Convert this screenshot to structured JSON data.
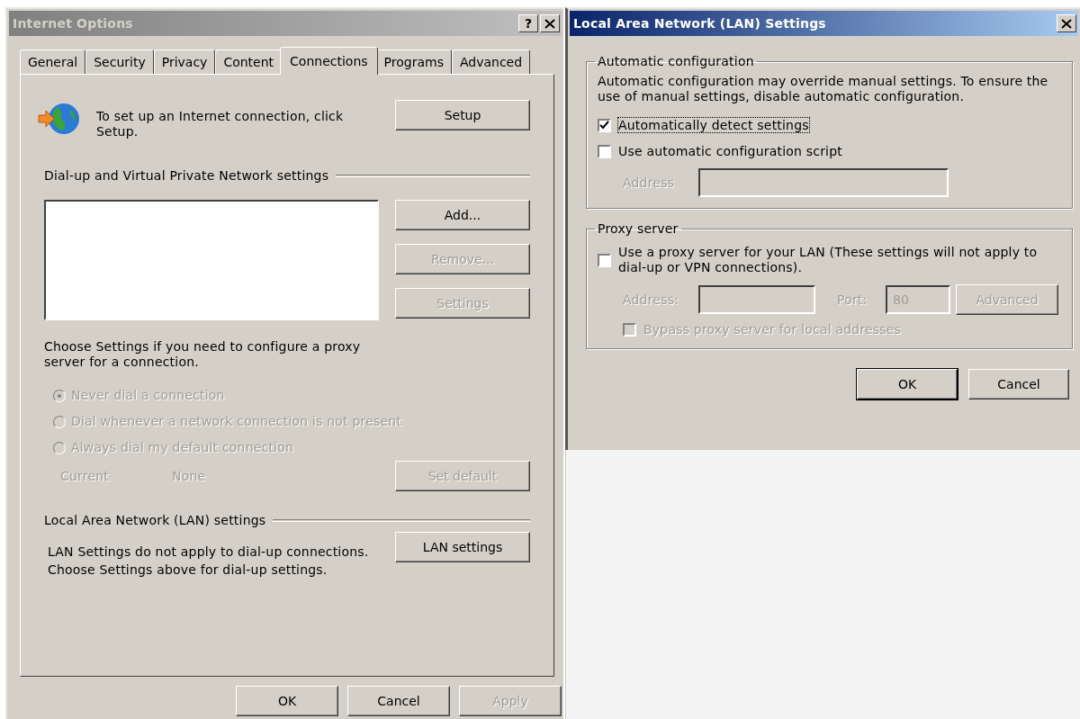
{
  "internet_options": {
    "title": "Internet Options",
    "help_button": "?",
    "tabs": [
      {
        "label": "General",
        "selected": false
      },
      {
        "label": "Security",
        "selected": false
      },
      {
        "label": "Privacy",
        "selected": false
      },
      {
        "label": "Content",
        "selected": false
      },
      {
        "label": "Connections",
        "selected": true
      },
      {
        "label": "Programs",
        "selected": false
      },
      {
        "label": "Advanced",
        "selected": false
      }
    ],
    "setup": {
      "text": "To set up an Internet connection, click Setup.",
      "button": "Setup"
    },
    "dialup": {
      "heading": "Dial-up and Virtual Private Network settings",
      "buttons": [
        {
          "label": "Add...",
          "disabled": false
        },
        {
          "label": "Remove...",
          "disabled": true
        },
        {
          "label": "Settings",
          "disabled": true
        }
      ]
    },
    "proxy_note": "Choose Settings if you need to configure a proxy server for a connection.",
    "dial_options": [
      {
        "label": "Never dial a connection",
        "selected": true,
        "disabled": true
      },
      {
        "label": "Dial whenever a network connection is not present",
        "selected": false,
        "disabled": true
      },
      {
        "label": "Always dial my default connection",
        "selected": false,
        "disabled": true
      }
    ],
    "current": {
      "label": "Current",
      "value": "None",
      "disabled": true
    },
    "set_default_button": {
      "label": "Set default",
      "disabled": true
    },
    "lan": {
      "heading": "Local Area Network (LAN) settings",
      "text": "LAN Settings do not apply to dial-up connections. Choose Settings above for dial-up settings.",
      "button": "LAN settings"
    },
    "footer_buttons": [
      {
        "label": "OK",
        "disabled": false
      },
      {
        "label": "Cancel",
        "disabled": false
      },
      {
        "label": "Apply",
        "disabled": true
      }
    ]
  },
  "lan_settings": {
    "title": "Local Area Network (LAN) Settings",
    "automatic_configuration": {
      "heading": "Automatic configuration",
      "text": "Automatic configuration may override manual settings.  To ensure the use of manual settings, disable automatic configuration.",
      "options": [
        {
          "label": "Automatically detect settings",
          "checked": true,
          "focused": true
        },
        {
          "label": "Use automatic configuration script",
          "checked": false,
          "focused": false
        }
      ],
      "address": {
        "label": "Address",
        "disabled": true
      }
    },
    "proxy_server": {
      "heading": "Proxy server",
      "option": {
        "label": "Use a proxy server for your LAN (These settings will not apply to dial-up or VPN connections).",
        "checked": false
      },
      "address": {
        "label": "Address:",
        "disabled": true
      },
      "port": {
        "label": "Port:",
        "value": "80",
        "disabled": true
      },
      "advanced_button": {
        "label": "Advanced",
        "disabled": true
      },
      "bypass": {
        "label": "Bypass proxy server for local addresses",
        "checked": false,
        "disabled": true
      }
    },
    "buttons": [
      {
        "label": "OK",
        "default": true
      },
      {
        "label": "Cancel",
        "default": false
      }
    ]
  }
}
